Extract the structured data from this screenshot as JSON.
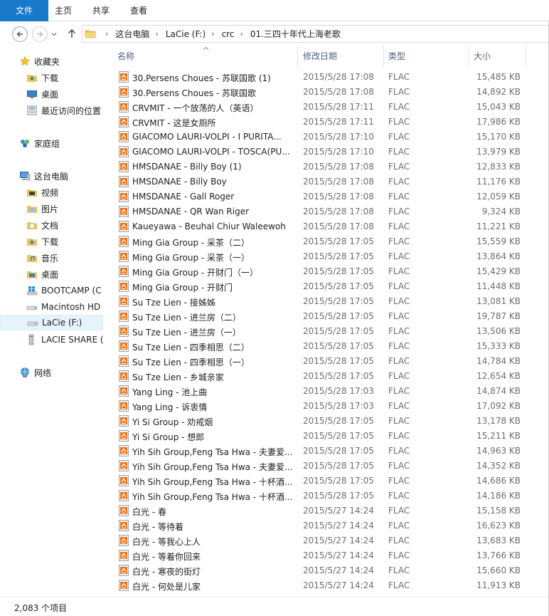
{
  "ribbon": {
    "tabs": [
      "文件",
      "主页",
      "共享",
      "查看"
    ]
  },
  "nav": {
    "back_icon": "back-arrow-icon",
    "forward_icon": "forward-arrow-icon",
    "up_icon": "up-arrow-icon",
    "breadcrumb": [
      "这台电脑",
      "LaCie (F:)",
      "crc",
      "01.三四十年代上海老歌"
    ]
  },
  "sidebar": {
    "favorites": {
      "label": "收藏夹",
      "items": [
        "下载",
        "桌面",
        "最近访问的位置"
      ]
    },
    "homegroup": {
      "label": "家庭组"
    },
    "thispc": {
      "label": "这台电脑",
      "items": [
        "视频",
        "图片",
        "文档",
        "下载",
        "音乐",
        "桌面",
        "BOOTCAMP (C",
        "Macintosh HD",
        "LaCie (F:)",
        "LACIE SHARE ("
      ]
    },
    "network": {
      "label": "网络"
    }
  },
  "columns": {
    "name": "名称",
    "date": "修改日期",
    "type": "类型",
    "size": "大小"
  },
  "files": [
    {
      "name": "30.Persens Choues - 苏联国歌 (1)",
      "date": "2015/5/28 17:08",
      "type": "FLAC",
      "size": "15,485 KB"
    },
    {
      "name": "30.Persens Choues - 苏联国歌",
      "date": "2015/5/28 17:08",
      "type": "FLAC",
      "size": "14,892 KB"
    },
    {
      "name": "CRVMIT - 一个放荡的人（英语）",
      "date": "2015/5/28 17:11",
      "type": "FLAC",
      "size": "15,043 KB"
    },
    {
      "name": "CRVMIT - 这是女厕所",
      "date": "2015/5/28 17:11",
      "type": "FLAC",
      "size": "17,986 KB"
    },
    {
      "name": "GIACOMO  LAURI-VOLPI - I PURITA...",
      "date": "2015/5/28 17:10",
      "type": "FLAC",
      "size": "15,170 KB"
    },
    {
      "name": "GIACOMO  LAURI-VOLPI - TOSCA(PU...",
      "date": "2015/5/28 17:10",
      "type": "FLAC",
      "size": "13,979 KB"
    },
    {
      "name": "HMSDANAE - Billy Boy (1)",
      "date": "2015/5/28 17:08",
      "type": "FLAC",
      "size": "12,833 KB"
    },
    {
      "name": "HMSDANAE - Billy Boy",
      "date": "2015/5/28 17:08",
      "type": "FLAC",
      "size": "11,176 KB"
    },
    {
      "name": "HMSDANAE - Gall Roger",
      "date": "2015/5/28 17:08",
      "type": "FLAC",
      "size": "12,059 KB"
    },
    {
      "name": "HMSDANAE - QR Wan Riger",
      "date": "2015/5/28 17:08",
      "type": "FLAC",
      "size": "9,324 KB"
    },
    {
      "name": "Kaueyawa - Beuhal Chiur Waleewoh",
      "date": "2015/5/28 17:08",
      "type": "FLAC",
      "size": "11,221 KB"
    },
    {
      "name": "Ming Gia Group - 采茶（二）",
      "date": "2015/5/28 17:05",
      "type": "FLAC",
      "size": "15,559 KB"
    },
    {
      "name": "Ming Gia Group - 采茶（一）",
      "date": "2015/5/28 17:05",
      "type": "FLAC",
      "size": "13,864 KB"
    },
    {
      "name": "Ming Gia Group - 开财门（一）",
      "date": "2015/5/28 17:05",
      "type": "FLAC",
      "size": "15,429 KB"
    },
    {
      "name": "Ming Gia Group - 开财门",
      "date": "2015/5/28 17:05",
      "type": "FLAC",
      "size": "11,448 KB"
    },
    {
      "name": "Su Tze Lien - 接姊姊",
      "date": "2015/5/28 17:05",
      "type": "FLAC",
      "size": "13,081 KB"
    },
    {
      "name": "Su Tze Lien - 进兰房（二）",
      "date": "2015/5/28 17:05",
      "type": "FLAC",
      "size": "19,787 KB"
    },
    {
      "name": "Su Tze Lien - 进兰房（一）",
      "date": "2015/5/28 17:05",
      "type": "FLAC",
      "size": "13,506 KB"
    },
    {
      "name": "Su Tze Lien - 四季相思（二）",
      "date": "2015/5/28 17:05",
      "type": "FLAC",
      "size": "15,333 KB"
    },
    {
      "name": "Su Tze Lien - 四季相思（一）",
      "date": "2015/5/28 17:05",
      "type": "FLAC",
      "size": "14,784 KB"
    },
    {
      "name": "Su Tze Lien - 乡城亲家",
      "date": "2015/5/28 17:05",
      "type": "FLAC",
      "size": "12,654 KB"
    },
    {
      "name": "Yang Ling - 池上曲",
      "date": "2015/5/28 17:03",
      "type": "FLAC",
      "size": "14,874 KB"
    },
    {
      "name": "Yang Ling - 诉衷情",
      "date": "2015/5/28 17:03",
      "type": "FLAC",
      "size": "17,092 KB"
    },
    {
      "name": "Yi Si Group - 劝戒烟",
      "date": "2015/5/28 17:05",
      "type": "FLAC",
      "size": "13,178 KB"
    },
    {
      "name": "Yi Si Group - 想郎",
      "date": "2015/5/28 17:05",
      "type": "FLAC",
      "size": "15,211 KB"
    },
    {
      "name": "Yih Sih Group,Feng Tsa Hwa - 夫妻爱...",
      "date": "2015/5/28 17:05",
      "type": "FLAC",
      "size": "14,963 KB"
    },
    {
      "name": "Yih Sih Group,Feng Tsa Hwa - 夫妻爱...",
      "date": "2015/5/28 17:05",
      "type": "FLAC",
      "size": "14,352 KB"
    },
    {
      "name": "Yih Sih Group,Feng Tsa Hwa - 十杯酒...",
      "date": "2015/5/28 17:05",
      "type": "FLAC",
      "size": "14,686 KB"
    },
    {
      "name": "Yih Sih Group,Feng Tsa Hwa - 十杯酒...",
      "date": "2015/5/28 17:05",
      "type": "FLAC",
      "size": "14,186 KB"
    },
    {
      "name": "白光 - 春",
      "date": "2015/5/27 14:24",
      "type": "FLAC",
      "size": "15,158 KB"
    },
    {
      "name": "白光 - 等待着",
      "date": "2015/5/27 14:24",
      "type": "FLAC",
      "size": "16,623 KB"
    },
    {
      "name": "白光 - 等我心上人",
      "date": "2015/5/27 14:24",
      "type": "FLAC",
      "size": "13,683 KB"
    },
    {
      "name": "白光 - 等着你回来",
      "date": "2015/5/27 14:24",
      "type": "FLAC",
      "size": "13,766 KB"
    },
    {
      "name": "白光 - 寒夜的街灯",
      "date": "2015/5/27 14:24",
      "type": "FLAC",
      "size": "15,660 KB"
    },
    {
      "name": "白光 - 何处是儿家",
      "date": "2015/5/27 14:24",
      "type": "FLAC",
      "size": "11,913 KB"
    }
  ],
  "status": {
    "item_count": "2,083 个项目"
  },
  "colors": {
    "file_tab": "#1979ca",
    "header_text": "#4d6082",
    "selected_bg": "#e5f3fb",
    "flac_icon_orange": "#e8751a"
  }
}
